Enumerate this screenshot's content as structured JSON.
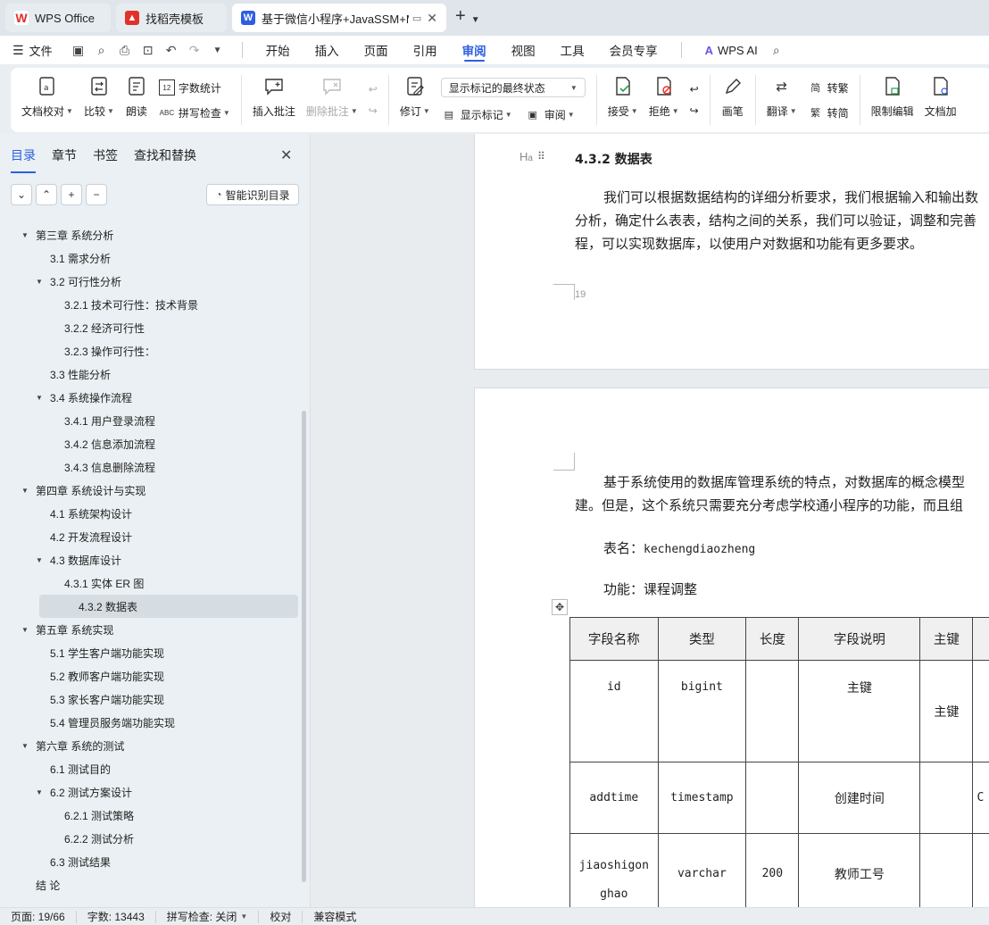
{
  "tabs": [
    {
      "label": "WPS Office"
    },
    {
      "label": "找稻壳模板"
    },
    {
      "label": "基于微信小程序+JavaSSM+M"
    }
  ],
  "menu": {
    "file": "文件",
    "tabs": [
      "开始",
      "插入",
      "页面",
      "引用",
      "审阅",
      "视图",
      "工具",
      "会员专享"
    ],
    "active_tab": "审阅",
    "ai": "WPS AI"
  },
  "ribbon": {
    "doc_check": "文档校对",
    "compare": "比较",
    "read": "朗读",
    "word_count": "字数统计",
    "spell_check": "拼写检查",
    "insert_comment": "插入批注",
    "delete_comment": "删除批注",
    "revision": "修订",
    "markup_select": "显示标记的最终状态",
    "show_markup": "显示标记",
    "review": "审阅",
    "accept": "接受",
    "reject": "拒绝",
    "pen": "画笔",
    "translate": "翻译",
    "to_traditional": "转繁",
    "to_simplified": "转简",
    "restrict_edit": "限制编辑",
    "doc_encrypt": "文档加"
  },
  "nav": {
    "tabs": [
      "目录",
      "章节",
      "书签",
      "查找和替换"
    ],
    "smart_btn": "智能识别目录",
    "toc": [
      {
        "label": "第三章  系统分析",
        "level": 1,
        "arrow": "▼"
      },
      {
        "label": "3.1 需求分析",
        "level": 2,
        "arrow": ""
      },
      {
        "label": "3.2 可行性分析",
        "level": 2,
        "arrow": "▼"
      },
      {
        "label": "3.2.1 技术可行性：技术背景",
        "level": 3,
        "arrow": ""
      },
      {
        "label": "3.2.2 经济可行性",
        "level": 3,
        "arrow": ""
      },
      {
        "label": "3.2.3 操作可行性：",
        "level": 3,
        "arrow": ""
      },
      {
        "label": "3.3 性能分析",
        "level": 2,
        "arrow": ""
      },
      {
        "label": "3.4 系统操作流程",
        "level": 2,
        "arrow": "▼"
      },
      {
        "label": "3.4.1 用户登录流程",
        "level": 3,
        "arrow": ""
      },
      {
        "label": "3.4.2 信息添加流程",
        "level": 3,
        "arrow": ""
      },
      {
        "label": "3.4.3 信息删除流程",
        "level": 3,
        "arrow": ""
      },
      {
        "label": "第四章  系统设计与实现",
        "level": 1,
        "arrow": "▼"
      },
      {
        "label": "4.1 系统架构设计",
        "level": 2,
        "arrow": ""
      },
      {
        "label": "4.2 开发流程设计",
        "level": 2,
        "arrow": ""
      },
      {
        "label": "4.3 数据库设计",
        "level": 2,
        "arrow": "▼"
      },
      {
        "label": "4.3.1 实体 ER 图",
        "level": 3,
        "arrow": ""
      },
      {
        "label": "4.3.2 数据表",
        "level": 3,
        "arrow": "",
        "selected": true
      },
      {
        "label": "第五章  系统实现",
        "level": 1,
        "arrow": "▼"
      },
      {
        "label": "5.1 学生客户端功能实现",
        "level": 2,
        "arrow": ""
      },
      {
        "label": "5.2 教师客户端功能实现",
        "level": 2,
        "arrow": ""
      },
      {
        "label": "5.3 家长客户端功能实现",
        "level": 2,
        "arrow": ""
      },
      {
        "label": "5.4  管理员服务端功能实现",
        "level": 2,
        "arrow": ""
      },
      {
        "label": "第六章    系统的测试",
        "level": 1,
        "arrow": "▼"
      },
      {
        "label": "6.1  测试目的",
        "level": 2,
        "arrow": ""
      },
      {
        "label": "6.2  测试方案设计",
        "level": 2,
        "arrow": "▼"
      },
      {
        "label": "6.2.1  测试策略",
        "level": 3,
        "arrow": ""
      },
      {
        "label": "6.2.2  测试分析",
        "level": 3,
        "arrow": ""
      },
      {
        "label": "6.3  测试结果",
        "level": 2,
        "arrow": ""
      },
      {
        "label": "结   论",
        "level": 1,
        "arrow": ""
      }
    ]
  },
  "doc": {
    "heading_marker": "H",
    "heading": "4.3.2 数据表",
    "p1": [
      "我们可以根据数据结构的详细分析要求，我们根据输入和输出数",
      "分析，确定什么表表，结构之间的关系，我们可以验证，调整和完善",
      "程，可以实现数据库，以使用户对数据和功能有更多要求。"
    ],
    "page_number": "19",
    "p2": [
      "基于系统使用的数据库管理系统的特点，对数据库的概念模型",
      "建。但是，这个系统只需要充分考虑学校通小程序的功能，而且组"
    ],
    "table_name_label": "表名：",
    "table_name": "kechengdiaozheng",
    "function_label": "功能：课程调整",
    "table": {
      "headers": [
        "字段名称",
        "类型",
        "长度",
        "字段说明",
        "主键",
        ""
      ],
      "rows": [
        {
          "name": "id",
          "type": "bigint",
          "length": "",
          "desc": "主键",
          "pk": "主键",
          "extra": ""
        },
        {
          "name": "addtime",
          "type": "timestamp",
          "length": "",
          "desc": "创建时间",
          "pk": "",
          "extra": "C"
        },
        {
          "name": "jiaoshigon\nghao",
          "type": "varchar",
          "length": "200",
          "desc": "教师工号",
          "pk": "",
          "extra": ""
        }
      ]
    }
  },
  "status": {
    "page": "页面: 19/66",
    "words": "字数: 13443",
    "spell": "拼写检查: 关闭",
    "proof": "校对",
    "compat": "兼容模式"
  }
}
